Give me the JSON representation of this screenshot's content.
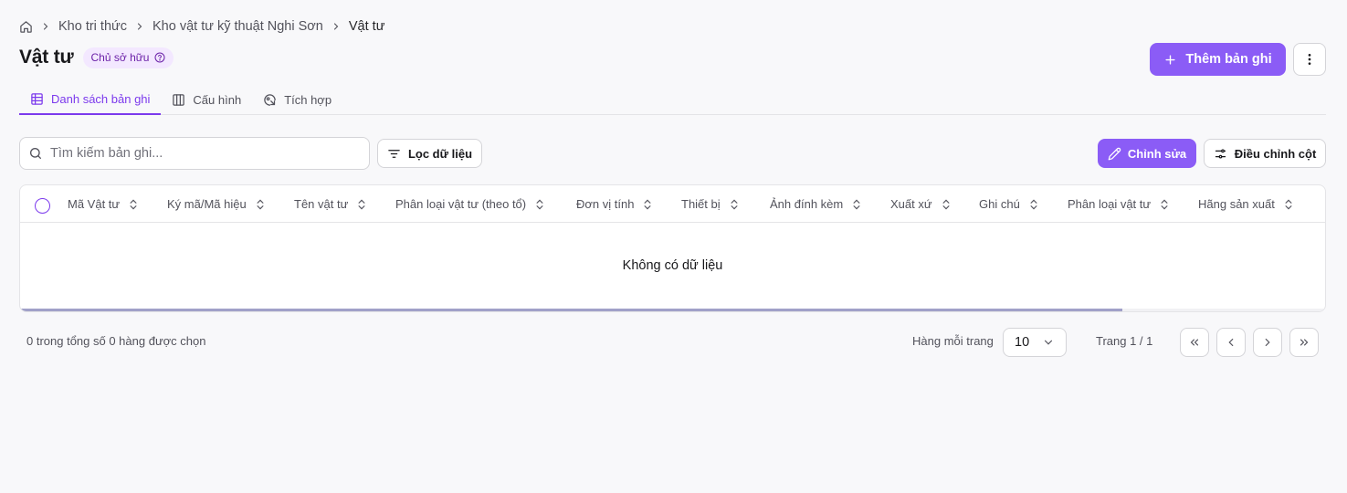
{
  "breadcrumb": {
    "items": [
      "Kho tri thức",
      "Kho vật tư kỹ thuật Nghi Sơn",
      "Vật tư"
    ]
  },
  "header": {
    "title": "Vật tư",
    "badge": "Chủ sở hữu",
    "add_button": "Thêm bản ghi"
  },
  "tabs": [
    {
      "label": "Danh sách bản ghi",
      "active": true,
      "icon": "table-icon"
    },
    {
      "label": "Cấu hình",
      "active": false,
      "icon": "columns-config-icon"
    },
    {
      "label": "Tích hợp",
      "active": false,
      "icon": "integration-icon"
    }
  ],
  "toolbar": {
    "search_placeholder": "Tìm kiếm bản ghi...",
    "filter_label": "Lọc dữ liệu",
    "edit_label": "Chỉnh sửa",
    "columns_label": "Điều chỉnh cột"
  },
  "table": {
    "columns": [
      "Mã Vật tư",
      "Ký mã/Mã hiệu",
      "Tên vật tư",
      "Phân loại vật tư (theo tổ)",
      "Đơn vị tính",
      "Thiết bị",
      "Ảnh đính kèm",
      "Xuất xứ",
      "Ghi chú",
      "Phân loại vật tư",
      "Hãng sản xuất"
    ],
    "empty_text": "Không có dữ liệu"
  },
  "footer": {
    "selected_info": "0 trong tổng số 0 hàng được chọn",
    "rows_per_page_label": "Hàng mỗi trang",
    "rows_per_page_value": "10",
    "page_info": "Trang 1 / 1"
  },
  "colors": {
    "accent": "#8b5cf6",
    "accent_dark": "#7c3aed",
    "background": "#f8f8fa",
    "badge_bg": "#f3e8ff"
  }
}
